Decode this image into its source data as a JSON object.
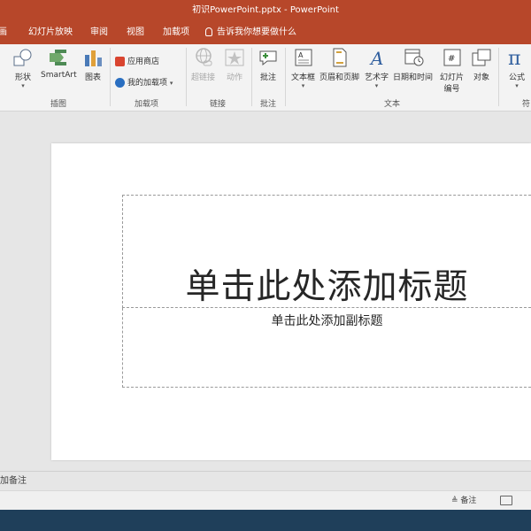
{
  "window": {
    "title": "初识PowerPoint.pptx - PowerPoint"
  },
  "tabs": [
    {
      "label": "画"
    },
    {
      "label": "幻灯片放映"
    },
    {
      "label": "审阅"
    },
    {
      "label": "视图"
    },
    {
      "label": "加载项"
    }
  ],
  "tell_me": {
    "label": "告诉我你想要做什么"
  },
  "ribbon": {
    "illustrations": {
      "shapes": "形状",
      "smartart": "SmartArt",
      "chart": "图表",
      "group_label": "插图"
    },
    "addins": {
      "store": "应用商店",
      "my_addins": "我的加载项",
      "group_label": "加载项"
    },
    "links": {
      "hyperlink": "超链接",
      "action": "动作",
      "group_label": "链接"
    },
    "comments": {
      "comment": "批注",
      "group_label": "批注"
    },
    "text": {
      "textbox": "文本框",
      "header_footer": "页眉和页脚",
      "wordart": "艺术字",
      "datetime": "日期和时间",
      "slide_number_line1": "幻灯片",
      "slide_number_line2": "编号",
      "object": "对象",
      "group_label": "文本"
    },
    "symbols": {
      "equation": "公式",
      "group_label": "符"
    }
  },
  "slide": {
    "title_placeholder": "单击此处添加标题",
    "subtitle_placeholder": "单击此处添加副标题"
  },
  "notes": {
    "label": "加备注"
  },
  "status": {
    "notes_button": "备注"
  },
  "colors": {
    "accent": "#b7472a",
    "taskbar": "#1f3f5a"
  }
}
